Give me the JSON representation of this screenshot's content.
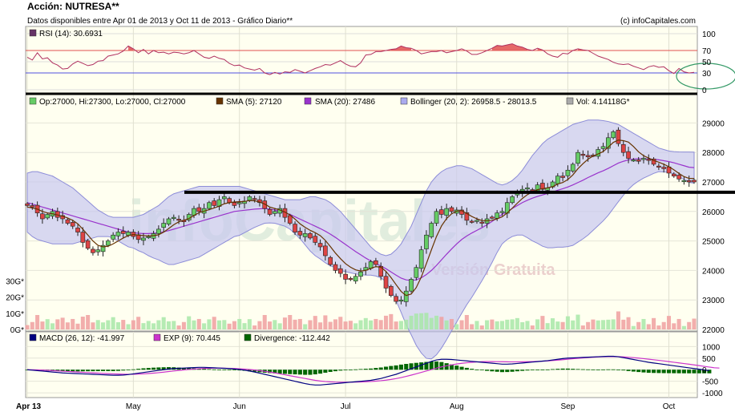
{
  "header": {
    "title": "Acción: NUTRESA**",
    "subtitle": "Datos disponibles entre Apr 01 de 2013 y Oct 11 de 2013 - Gráfico Diario**",
    "credit": "(c) infoCapitales.com"
  },
  "watermark": {
    "brand": "infoCapitales",
    "edition": "Versión Gratuita"
  },
  "colors": {
    "panel_bg": "#fffff0",
    "up_candle": "#66cc66",
    "down_candle": "#dd4444",
    "sma5": "#663300",
    "sma20": "#9933cc",
    "bollinger_fill": "#c8c8f0",
    "rsi_line": "#b03060",
    "rsi_overbought": "#e05050",
    "rsi_oversold": "#5050e0",
    "macd": "#000080",
    "macd_signal": "#cc33cc",
    "divergence": "#006600",
    "annotation_line": "#000000",
    "annotation_circle": "#339966",
    "watermark": "#d8e8d8"
  },
  "chart_data": [
    {
      "id": "rsi",
      "type": "line",
      "legend": "RSI (14): 30.6931",
      "ylim": [
        0,
        100
      ],
      "yticks": [
        "100",
        "70",
        "50",
        "30",
        "0"
      ],
      "ytick_values": [
        100,
        70,
        50,
        30,
        0
      ],
      "reference_lines": [
        70,
        30
      ],
      "values": [
        58,
        53,
        66,
        55,
        57,
        48,
        44,
        37,
        38,
        46,
        51,
        47,
        43,
        45,
        51,
        52,
        60,
        62,
        64,
        69,
        78,
        73,
        66,
        72,
        64,
        70,
        66,
        67,
        64,
        67,
        66,
        64,
        66,
        70,
        64,
        58,
        56,
        60,
        56,
        54,
        47,
        43,
        44,
        39,
        37,
        35,
        38,
        30,
        27,
        31,
        28,
        32,
        31,
        36,
        33,
        30,
        34,
        38,
        41,
        45,
        44,
        48,
        52,
        46,
        42,
        41,
        48,
        62,
        63,
        68,
        68,
        70,
        72,
        73,
        78,
        75,
        74,
        70,
        64,
        66,
        68,
        68,
        70,
        66,
        68,
        70,
        73,
        69,
        63,
        63,
        66,
        70,
        74,
        79,
        78,
        80,
        82,
        78,
        76,
        72,
        70,
        74,
        71,
        64,
        60,
        58,
        65,
        64,
        70,
        73,
        71,
        70,
        65,
        60,
        57,
        54,
        49,
        46,
        45,
        46,
        42,
        39,
        36,
        41,
        43,
        40,
        41,
        34,
        29,
        38,
        32,
        30,
        31
      ]
    },
    {
      "id": "price",
      "type": "candlestick",
      "legends": [
        "Op:27000, Hi:27300, Lo:27000, Cl:27000",
        "SMA (5): 27120",
        "SMA (20): 27486",
        "Bollinger (20, 2): 26958.5 - 28013.5",
        "Vol: 4.14118G*"
      ],
      "ylim": [
        22000,
        29500
      ],
      "yticks": [
        "29000",
        "28000",
        "27000",
        "26000",
        "25000",
        "24000",
        "23000",
        "22000"
      ],
      "ytick_values": [
        29000,
        28000,
        27000,
        26000,
        25000,
        24000,
        23000,
        22000
      ],
      "volume_ticks": [
        "30G*",
        "20G*",
        "10G*",
        "0G*"
      ],
      "volume_tick_values": [
        30,
        20,
        10,
        0
      ],
      "volume_max": 40,
      "annotation_level": 26650,
      "close": [
        26200,
        26150,
        25950,
        25750,
        25900,
        26000,
        25800,
        25750,
        25600,
        25500,
        25300,
        24950,
        24750,
        24600,
        24700,
        24850,
        25000,
        25200,
        25300,
        25250,
        25300,
        25150,
        25050,
        25100,
        25150,
        25250,
        25400,
        25600,
        25750,
        25800,
        25700,
        25650,
        25900,
        26100,
        26000,
        26100,
        26300,
        26200,
        26400,
        26500,
        26300,
        26200,
        26300,
        26350,
        26500,
        26400,
        26300,
        26100,
        25900,
        26000,
        26100,
        25800,
        25600,
        25300,
        25200,
        25250,
        25100,
        24950,
        24800,
        24500,
        24200,
        24000,
        23900,
        23700,
        23700,
        23800,
        23950,
        24100,
        24300,
        24200,
        23800,
        23400,
        23150,
        22950,
        23000,
        23300,
        23700,
        24100,
        24700,
        25200,
        25600,
        26000,
        25900,
        26100,
        26000,
        26050,
        25900,
        25700,
        25650,
        25700,
        25600,
        25750,
        25800,
        25950,
        26000,
        26300,
        26500,
        26650,
        26750,
        26800,
        26700,
        26900,
        26750,
        26800,
        27000,
        27200,
        27150,
        27400,
        27600,
        28000,
        27900,
        27850,
        27900,
        28100,
        28200,
        28500,
        28700,
        28300,
        28000,
        27800,
        27750,
        27700,
        27800,
        27750,
        27600,
        27500,
        27450,
        27300,
        27200,
        27100,
        27050,
        27000,
        27000
      ],
      "sma5": [
        26150,
        26120,
        26080,
        26000,
        25950,
        25920,
        25880,
        25840,
        25780,
        25700,
        25580,
        25400,
        25200,
        25000,
        24850,
        24800,
        24820,
        24900,
        25000,
        25100,
        25180,
        25220,
        25200,
        25180,
        25170,
        25180,
        25210,
        25300,
        25420,
        25550,
        25650,
        25700,
        25760,
        25860,
        25960,
        26010,
        26060,
        26120,
        26180,
        26260,
        26300,
        26320,
        26330,
        26340,
        26370,
        26360,
        26320,
        26250,
        26150,
        26100,
        26050,
        25980,
        25880,
        25740,
        25580,
        25460,
        25360,
        25280,
        25180,
        25020,
        24810,
        24590,
        24400,
        24230,
        24110,
        24020,
        23980,
        24000,
        24070,
        24130,
        24110,
        23970,
        23760,
        23520,
        23290,
        23150,
        23200,
        23420,
        23780,
        24230,
        24700,
        25150,
        25510,
        25760,
        25920,
        26010,
        26030,
        25930,
        25830,
        25750,
        25690,
        25680,
        25700,
        25750,
        25820,
        25950,
        26110,
        26280,
        26440,
        26570,
        26660,
        26740,
        26770,
        26800,
        26840,
        26930,
        26980,
        27080,
        27240,
        27450,
        27620,
        27770,
        27880,
        27950,
        28030,
        28180,
        28340,
        28420,
        28400,
        28350,
        28200,
        28020,
        27890,
        27810,
        27730,
        27670,
        27600,
        27520,
        27410,
        27290,
        27180,
        27120,
        27120
      ],
      "sma20": [
        26300,
        26250,
        26200,
        26150,
        26100,
        26050,
        26000,
        25950,
        25900,
        25850,
        25800,
        25750,
        25700,
        25650,
        25600,
        25550,
        25500,
        25450,
        25400,
        25350,
        25300,
        25280,
        25260,
        25250,
        25250,
        25260,
        25280,
        25310,
        25350,
        25400,
        25450,
        25500,
        25550,
        25600,
        25650,
        25700,
        25750,
        25800,
        25850,
        25900,
        25950,
        26000,
        26020,
        26040,
        26060,
        26080,
        26090,
        26100,
        26080,
        26050,
        26000,
        25950,
        25900,
        25820,
        25740,
        25660,
        25580,
        25500,
        25420,
        25330,
        25230,
        25120,
        25000,
        24880,
        24760,
        24640,
        24530,
        24420,
        24320,
        24230,
        24150,
        24060,
        23950,
        23840,
        23740,
        23680,
        23660,
        23680,
        23750,
        23860,
        24000,
        24170,
        24360,
        24550,
        24730,
        24900,
        25050,
        25170,
        25270,
        25360,
        25450,
        25550,
        25660,
        25780,
        25900,
        26000,
        26100,
        26200,
        26300,
        26380,
        26450,
        26510,
        26560,
        26610,
        26660,
        26720,
        26770,
        26830,
        26900,
        26980,
        27060,
        27150,
        27230,
        27310,
        27380,
        27460,
        27550,
        27640,
        27700,
        27750,
        27780,
        27790,
        27790,
        27780,
        27770,
        27750,
        27720,
        27690,
        27650,
        27600,
        27550,
        27500,
        27486
      ],
      "bb_upper": [
        27300,
        27350,
        27350,
        27300,
        27250,
        27200,
        27100,
        27000,
        26900,
        26800,
        26650,
        26500,
        26350,
        26200,
        26050,
        25950,
        25850,
        25800,
        25800,
        25800,
        25800,
        25800,
        25850,
        25900,
        26000,
        26100,
        26200,
        26350,
        26500,
        26600,
        26650,
        26700,
        26750,
        26800,
        26850,
        26850,
        26850,
        26850,
        26850,
        26850,
        26850,
        26850,
        26850,
        26800,
        26750,
        26700,
        26650,
        26600,
        26550,
        26500,
        26450,
        26400,
        26400,
        26400,
        26400,
        26450,
        26500,
        26500,
        26450,
        26400,
        26300,
        26150,
        26000,
        25800,
        25600,
        25400,
        25200,
        25000,
        24800,
        24650,
        24550,
        24500,
        24550,
        24700,
        24900,
        25200,
        25500,
        25900,
        26300,
        26700,
        27000,
        27200,
        27350,
        27450,
        27500,
        27550,
        27550,
        27500,
        27450,
        27350,
        27250,
        27150,
        27050,
        26950,
        26900,
        26950,
        27050,
        27200,
        27400,
        27650,
        27900,
        28100,
        28300,
        28450,
        28550,
        28650,
        28750,
        28850,
        28950,
        29000,
        29050,
        29100,
        29100,
        29100,
        29080,
        29050,
        29000,
        28950,
        28850,
        28750,
        28650,
        28550,
        28450,
        28350,
        28250,
        28150,
        28100,
        28050,
        28030,
        28020,
        28015,
        28014,
        28013
      ]
    },
    {
      "id": "macd",
      "type": "line",
      "legends": [
        "MACD (26, 12): -41.997",
        "EXP (9): 70.445",
        "Divergence: -112.442"
      ],
      "ylim": [
        -1100,
        1150
      ],
      "yticks": [
        "1000",
        "500",
        "0",
        "-500",
        "-1000"
      ],
      "ytick_values": [
        1000,
        500,
        0,
        -500,
        -1000
      ],
      "macd": [
        0,
        -20,
        -40,
        -60,
        -80,
        -100,
        -120,
        -140,
        -150,
        -160,
        -170,
        -180,
        -190,
        -200,
        -210,
        -220,
        -230,
        -240,
        -240,
        -230,
        -210,
        -180,
        -150,
        -120,
        -90,
        -60,
        -30,
        0,
        30,
        50,
        60,
        70,
        80,
        90,
        100,
        100,
        90,
        80,
        70,
        60,
        50,
        30,
        10,
        -20,
        -60,
        -100,
        -150,
        -200,
        -250,
        -300,
        -350,
        -400,
        -450,
        -500,
        -550,
        -600,
        -640,
        -660,
        -660,
        -640,
        -620,
        -600,
        -580,
        -560,
        -540,
        -520,
        -500,
        -480,
        -460,
        -420,
        -380,
        -320,
        -260,
        -200,
        -120,
        -40,
        40,
        120,
        200,
        280,
        360,
        420,
        450,
        450,
        440,
        420,
        400,
        380,
        360,
        340,
        320,
        300,
        280,
        260,
        240,
        240,
        250,
        270,
        290,
        310,
        330,
        350,
        370,
        390,
        420,
        450,
        480,
        500,
        510,
        520,
        530,
        540,
        550,
        560,
        570,
        580,
        580,
        560,
        520,
        480,
        440,
        400,
        360,
        320,
        290,
        260,
        230,
        200,
        170,
        140,
        110,
        80,
        50,
        20,
        -10,
        -42
      ],
      "signal": [
        0,
        -5,
        -10,
        -18,
        -28,
        -40,
        -52,
        -64,
        -76,
        -88,
        -100,
        -112,
        -124,
        -136,
        -148,
        -160,
        -170,
        -180,
        -188,
        -194,
        -197,
        -196,
        -190,
        -180,
        -166,
        -148,
        -128,
        -105,
        -80,
        -55,
        -32,
        -10,
        10,
        28,
        44,
        56,
        64,
        68,
        68,
        64,
        58,
        50,
        40,
        26,
        8,
        -14,
        -40,
        -70,
        -105,
        -140,
        -180,
        -220,
        -260,
        -300,
        -340,
        -380,
        -420,
        -460,
        -490,
        -510,
        -525,
        -535,
        -540,
        -542,
        -540,
        -535,
        -528,
        -520,
        -510,
        -495,
        -475,
        -450,
        -420,
        -385,
        -340,
        -290,
        -235,
        -175,
        -115,
        -55,
        5,
        65,
        120,
        170,
        210,
        245,
        275,
        300,
        320,
        335,
        345,
        350,
        350,
        348,
        344,
        340,
        338,
        338,
        340,
        345,
        350,
        358,
        368,
        380,
        395,
        412,
        432,
        452,
        472,
        492,
        510,
        526,
        540,
        552,
        560,
        565,
        566,
        562,
        552,
        538,
        520,
        500,
        478,
        454,
        430,
        404,
        378,
        350,
        322,
        294,
        265,
        236,
        206,
        176,
        145,
        114,
        83,
        70
      ]
    }
  ],
  "x_axis": {
    "labels": [
      "Apr 13",
      "May",
      "Jun",
      "Jul",
      "Aug",
      "Sep",
      "Oct"
    ],
    "label_day_index": [
      0,
      21,
      42,
      63,
      85,
      107,
      127
    ],
    "days": 133
  }
}
